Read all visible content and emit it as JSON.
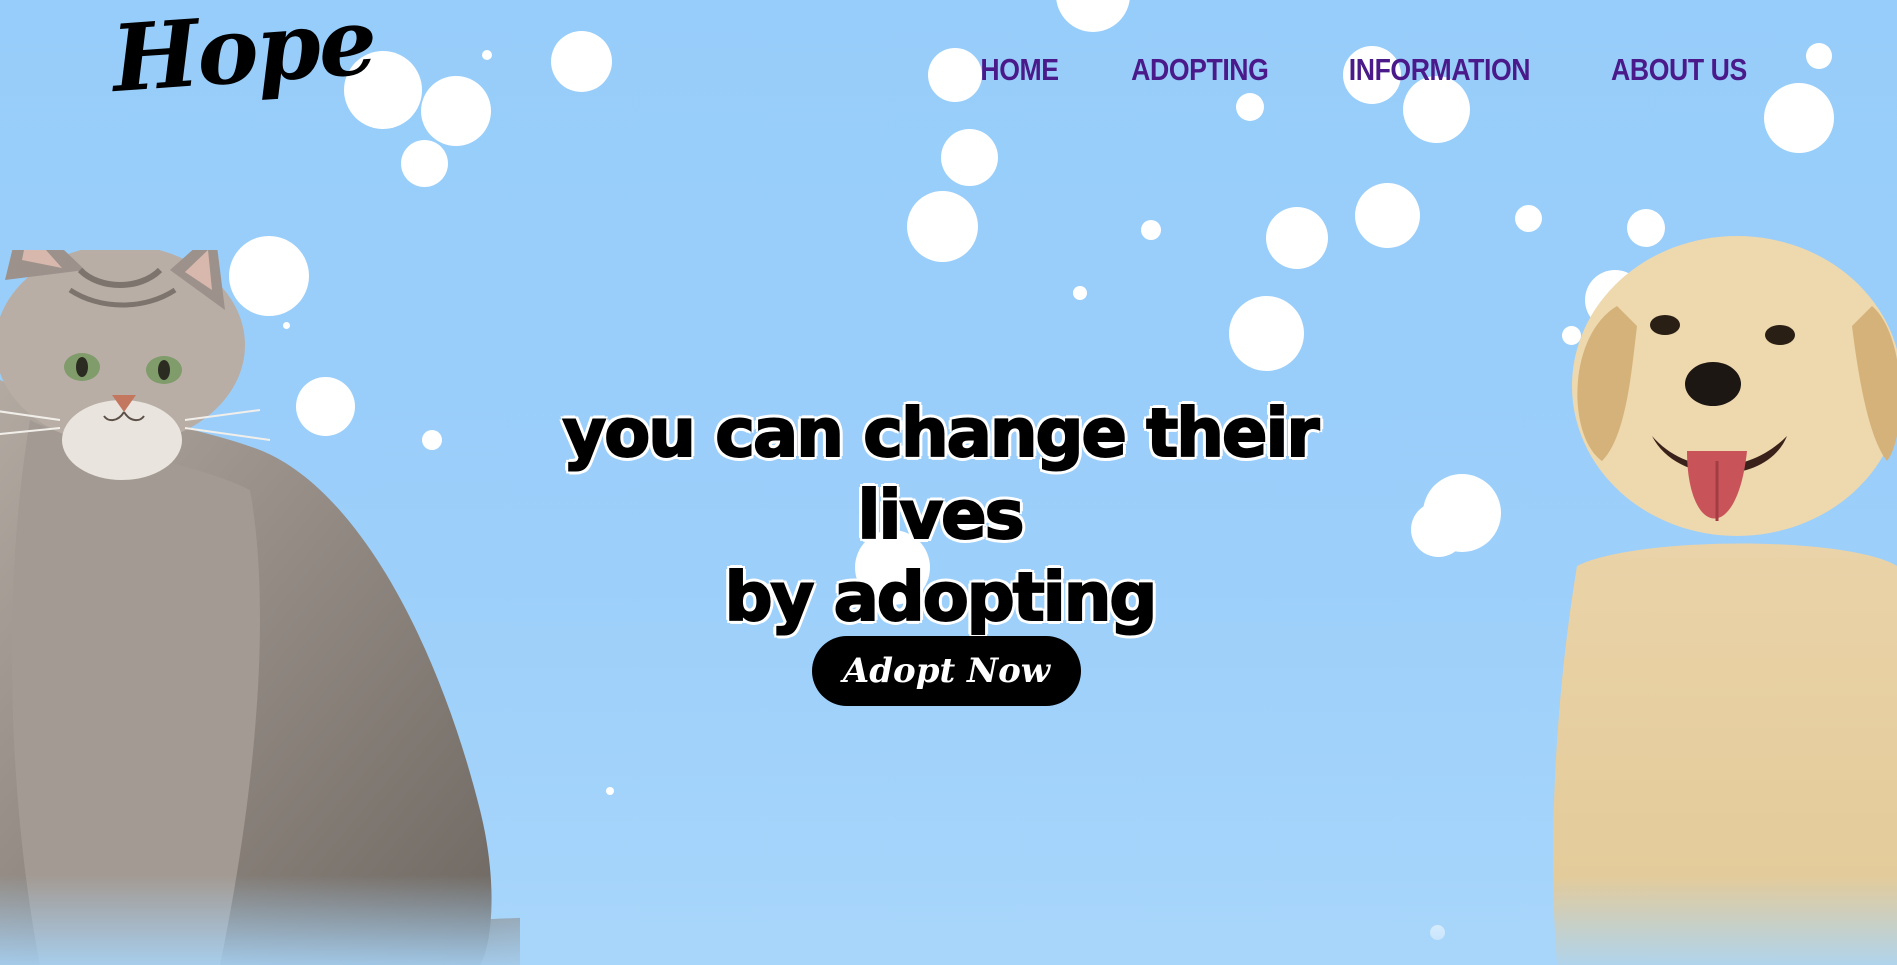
{
  "logo": {
    "text": "Hope"
  },
  "nav": {
    "items": [
      {
        "label": "HOME"
      },
      {
        "label": "ADOPTING"
      },
      {
        "label": "INFORMATION"
      },
      {
        "label": "ABOUT US"
      }
    ]
  },
  "hero": {
    "headline_line1": "you can change their lives",
    "headline_line2": "by adopting",
    "cta_label": "Adopt Now"
  },
  "colors": {
    "background": "#97cdfa",
    "nav_text": "#4b1a8a",
    "button_bg": "#000000",
    "button_text": "#ffffff",
    "bubbles": "#ffffff"
  },
  "images": {
    "left": "cat-photo",
    "right": "puppy-photo"
  }
}
